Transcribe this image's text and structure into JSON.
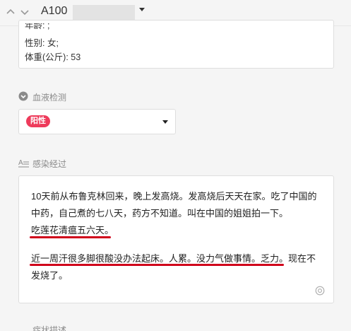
{
  "header": {
    "record_id": "A100",
    "icons": [
      "chevron-up-icon",
      "chevron-down-icon",
      "caret-down-icon"
    ]
  },
  "patient_info": {
    "age_label_partial": "年龄: ;",
    "gender": "性别: 女;",
    "weight": "体重(公斤): 53"
  },
  "blood_test": {
    "label": "血液检测",
    "icon": "chevron-circle-icon",
    "value": "阳性",
    "badge_color": "#ee3b5b"
  },
  "infection_process": {
    "label": "感染经过",
    "icon": "text-format-icon",
    "lines": [
      "10天前从布鲁克林回来，晚上发高烧。发高烧后天天在家。吃了中国的",
      "中药，自己煮的七八天，药方不知道。叫在中国的姐姐拍一下。",
      "吃莲花清瘟五六天。",
      "近一周汗很多脚很酸没办法起床。人累。没力气做事情。乏力。现在不",
      "发烧了。"
    ],
    "underline_color": "#d0021b"
  },
  "next_section": {
    "label_partial": "症状描述"
  }
}
